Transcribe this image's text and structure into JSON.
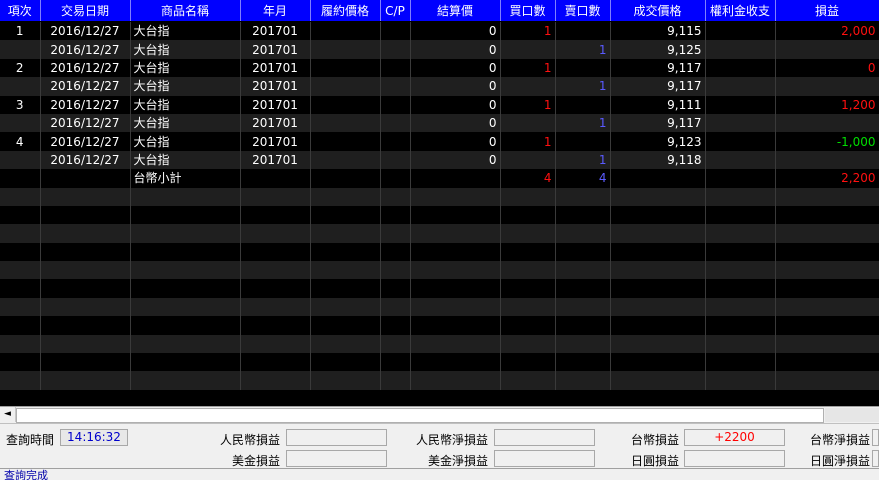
{
  "columns": [
    "項次",
    "交易日期",
    "商品名稱",
    "年月",
    "履約價格",
    "C/P",
    "結算價",
    "買口數",
    "賣口數",
    "成交價格",
    "權利金收支",
    "損益"
  ],
  "rows": [
    {
      "idx": "1",
      "date": "2016/12/27",
      "name": "大台指",
      "ym": "201701",
      "strike": "",
      "cp": "",
      "settle": "0",
      "buy": "1",
      "sell": "",
      "price": "9,115",
      "premium": "",
      "pl": "2,000",
      "pl_color": "red"
    },
    {
      "idx": "",
      "date": "2016/12/27",
      "name": "大台指",
      "ym": "201701",
      "strike": "",
      "cp": "",
      "settle": "0",
      "buy": "",
      "sell": "1",
      "price": "9,125",
      "premium": "",
      "pl": "",
      "pl_color": ""
    },
    {
      "idx": "2",
      "date": "2016/12/27",
      "name": "大台指",
      "ym": "201701",
      "strike": "",
      "cp": "",
      "settle": "0",
      "buy": "1",
      "sell": "",
      "price": "9,117",
      "premium": "",
      "pl": "0",
      "pl_color": "red"
    },
    {
      "idx": "",
      "date": "2016/12/27",
      "name": "大台指",
      "ym": "201701",
      "strike": "",
      "cp": "",
      "settle": "0",
      "buy": "",
      "sell": "1",
      "price": "9,117",
      "premium": "",
      "pl": "",
      "pl_color": ""
    },
    {
      "idx": "3",
      "date": "2016/12/27",
      "name": "大台指",
      "ym": "201701",
      "strike": "",
      "cp": "",
      "settle": "0",
      "buy": "1",
      "sell": "",
      "price": "9,111",
      "premium": "",
      "pl": "1,200",
      "pl_color": "red"
    },
    {
      "idx": "",
      "date": "2016/12/27",
      "name": "大台指",
      "ym": "201701",
      "strike": "",
      "cp": "",
      "settle": "0",
      "buy": "",
      "sell": "1",
      "price": "9,117",
      "premium": "",
      "pl": "",
      "pl_color": ""
    },
    {
      "idx": "4",
      "date": "2016/12/27",
      "name": "大台指",
      "ym": "201701",
      "strike": "",
      "cp": "",
      "settle": "0",
      "buy": "1",
      "sell": "",
      "price": "9,123",
      "premium": "",
      "pl": "-1,000",
      "pl_color": "green"
    },
    {
      "idx": "",
      "date": "2016/12/27",
      "name": "大台指",
      "ym": "201701",
      "strike": "",
      "cp": "",
      "settle": "0",
      "buy": "",
      "sell": "1",
      "price": "9,118",
      "premium": "",
      "pl": "",
      "pl_color": ""
    },
    {
      "idx": "",
      "date": "",
      "name": "台幣小計",
      "ym": "",
      "strike": "",
      "cp": "",
      "settle": "",
      "buy": "4",
      "sell": "4",
      "price": "",
      "premium": "",
      "pl": "2,200",
      "pl_color": "red"
    }
  ],
  "empty_row_count": 11,
  "footer": {
    "query_time_label": "查詢時間",
    "query_time_value": "14:16:32",
    "rmb_pl_label": "人民幣損益",
    "rmb_pl_value": "",
    "rmb_net_label": "人民幣淨損益",
    "rmb_net_value": "",
    "twd_pl_label": "台幣損益",
    "twd_pl_value": "+2200",
    "twd_net_label": "台幣淨損益",
    "twd_net_value": "",
    "usd_pl_label": "美金損益",
    "usd_pl_value": "",
    "usd_net_label": "美金淨損益",
    "usd_net_value": "",
    "jpy_pl_label": "日圓損益",
    "jpy_pl_value": "",
    "jpy_net_label": "日圓淨損益",
    "jpy_net_value": ""
  },
  "status_text": "查詢完成",
  "colors": {
    "header_bg": "#0000ff",
    "buy": "#ff1010",
    "sell": "#5a5aff",
    "profit": "#ff1010",
    "loss": "#00dd00"
  },
  "icons": {
    "scroll_left": "scroll-left-arrow-icon"
  }
}
